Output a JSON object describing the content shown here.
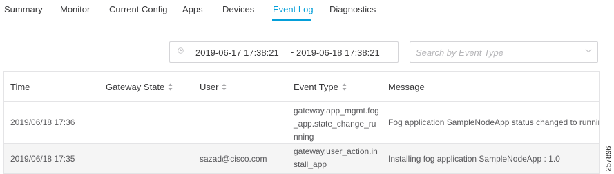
{
  "tabs": [
    {
      "label": "Summary",
      "active": false
    },
    {
      "label": "Monitor",
      "active": false
    },
    {
      "label": "Current Config",
      "active": false
    },
    {
      "label": "Apps",
      "active": false
    },
    {
      "label": "Devices",
      "active": false
    },
    {
      "label": "Event Log",
      "active": true
    },
    {
      "label": "Diagnostics",
      "active": false
    }
  ],
  "filters": {
    "date_from": "2019-06-17 17:38:21",
    "date_separator": "-",
    "date_to": "2019-06-18 17:38:21",
    "event_type_placeholder": "Search by Event Type"
  },
  "table": {
    "columns": [
      "Time",
      "Gateway State",
      "User",
      "Event Type",
      "Message"
    ],
    "rows": [
      {
        "time": "2019/06/18 17:36",
        "gateway_state": "",
        "user": "",
        "event_type": "gateway.app_mgmt.fog_app.state_change_running",
        "message": "Fog application SampleNodeApp status changed to running"
      },
      {
        "time": "2019/06/18 17:35",
        "gateway_state": "",
        "user": "sazad@cisco.com",
        "event_type": "gateway.user_action.install_app",
        "message": "Installing fog application SampleNodeApp : 1.0"
      }
    ]
  },
  "figure_id": "257896",
  "colors": {
    "accent": "#049fd9",
    "text": "#39393b",
    "muted_text": "#58585b",
    "border": "#e4e4e6",
    "row_alt": "#f5f5f5"
  },
  "icons": {
    "date_picker": "clock-icon",
    "dropdown": "chevron-down-icon",
    "sort": "sort-icon"
  }
}
